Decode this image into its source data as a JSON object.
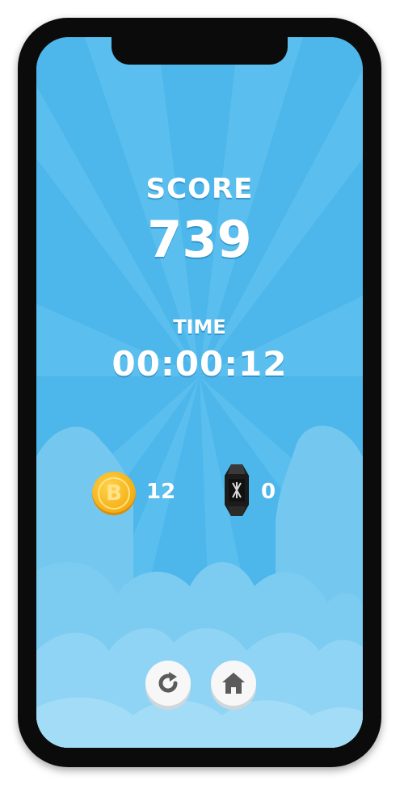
{
  "score": {
    "label": "SCORE",
    "value": "739"
  },
  "time": {
    "label": "TIME",
    "value": "00:00:12"
  },
  "collectibles": {
    "coin_icon": "bitcoin-coin-icon",
    "coin_symbol": "B",
    "coin_count": "12",
    "gem_icon": "crystal-gem-icon",
    "gem_count": "0"
  },
  "buttons": {
    "restart_icon": "restart-icon",
    "home_icon": "home-icon"
  },
  "colors": {
    "sky": "#4fb8ec",
    "ray": "#6ccbf5",
    "cloud": "#8fd3f3",
    "coin": "#f5b21a",
    "button": "#f7f7f7",
    "icon": "#5b5b5b"
  }
}
